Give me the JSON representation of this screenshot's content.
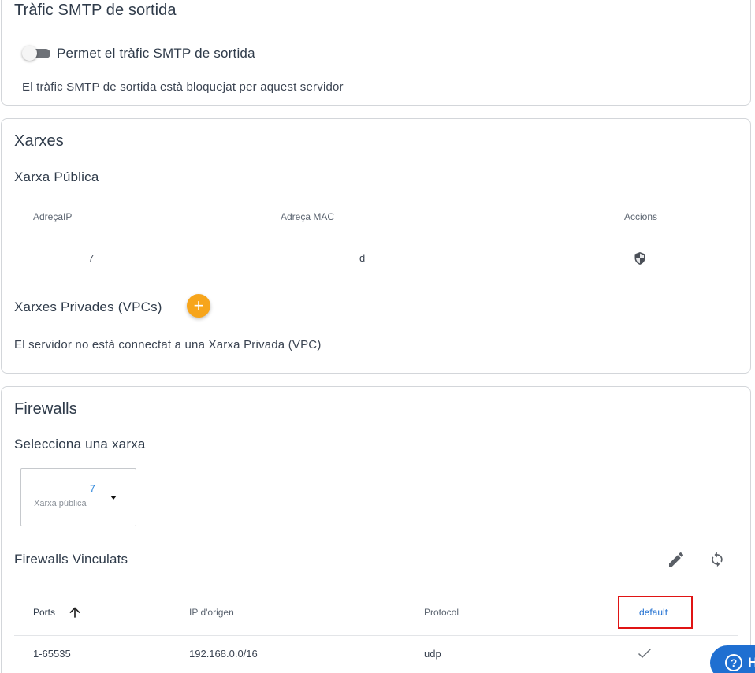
{
  "smtp": {
    "title": "Tràfic SMTP de sortida",
    "toggle_label": "Permet el tràfic SMTP de sortida",
    "status_text": "El tràfic SMTP de sortida està bloquejat per aquest servidor"
  },
  "networks": {
    "title": "Xarxes",
    "public": {
      "title": "Xarxa Pública",
      "columns": [
        "AdreçaIP",
        "Adreça MAC",
        "Accions"
      ],
      "row": {
        "ip": "7",
        "mac": "d"
      }
    },
    "private": {
      "title": "Xarxes Privades (VPCs)",
      "add_label": "+",
      "empty_text": "El servidor no està connectat a una Xarxa Privada (VPC)"
    }
  },
  "firewalls": {
    "title": "Firewalls",
    "select_network_title": "Selecciona una xarxa",
    "select": {
      "value": "7",
      "subtitle": "Xarxa pública"
    },
    "linked_title": "Firewalls Vinculats",
    "columns": {
      "ports": "Ports",
      "source_ip": "IP d'origen",
      "protocol": "Protocol",
      "default": "default"
    },
    "rows": [
      {
        "ports": "1-65535",
        "source_ip": "192.168.0.0/16",
        "protocol": "udp"
      }
    ]
  },
  "help": {
    "label": "H"
  },
  "colors": {
    "accent": "#f7a51b",
    "link": "#1f6fd1",
    "highlight": "#e01414"
  }
}
